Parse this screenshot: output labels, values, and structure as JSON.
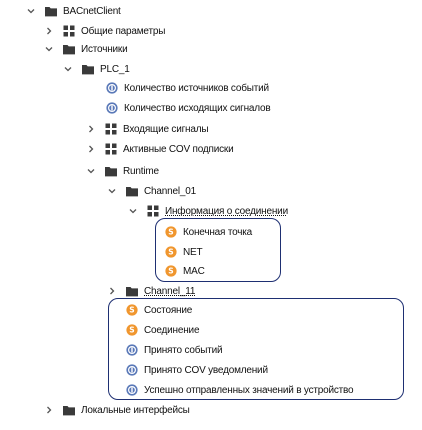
{
  "tree": {
    "root": "BACnetClient",
    "general_params": "Общие параметры",
    "sources": "Источники",
    "plc": "PLC_1",
    "event_sources_count": "Количество источников событий",
    "outgoing_signals_count": "Количество исходящих сигналов",
    "incoming_signals": "Входящие сигналы",
    "active_cov": "Активные COV подписки",
    "runtime": "Runtime",
    "channel_01": "Channel_01",
    "connection_info": "Информация о соединении",
    "endpoint": "Конечная точка",
    "net": "NET",
    "mac": "MAC",
    "channel_11": "Channel_11",
    "state": "Состояние",
    "connection": "Соединение",
    "events_received": "Принято событий",
    "cov_received": "Принято COV уведомлений",
    "values_sent": "Успешно отправленных значений в устройство",
    "local_interfaces": "Локальные интерфейсы"
  },
  "colors": {
    "folder": "#3a3a3a",
    "grid_icon": "#3a3a3a",
    "orange_badge": "#f0962e",
    "blue_badge": "#5a79b8",
    "highlight_border": "#1e2f72"
  }
}
